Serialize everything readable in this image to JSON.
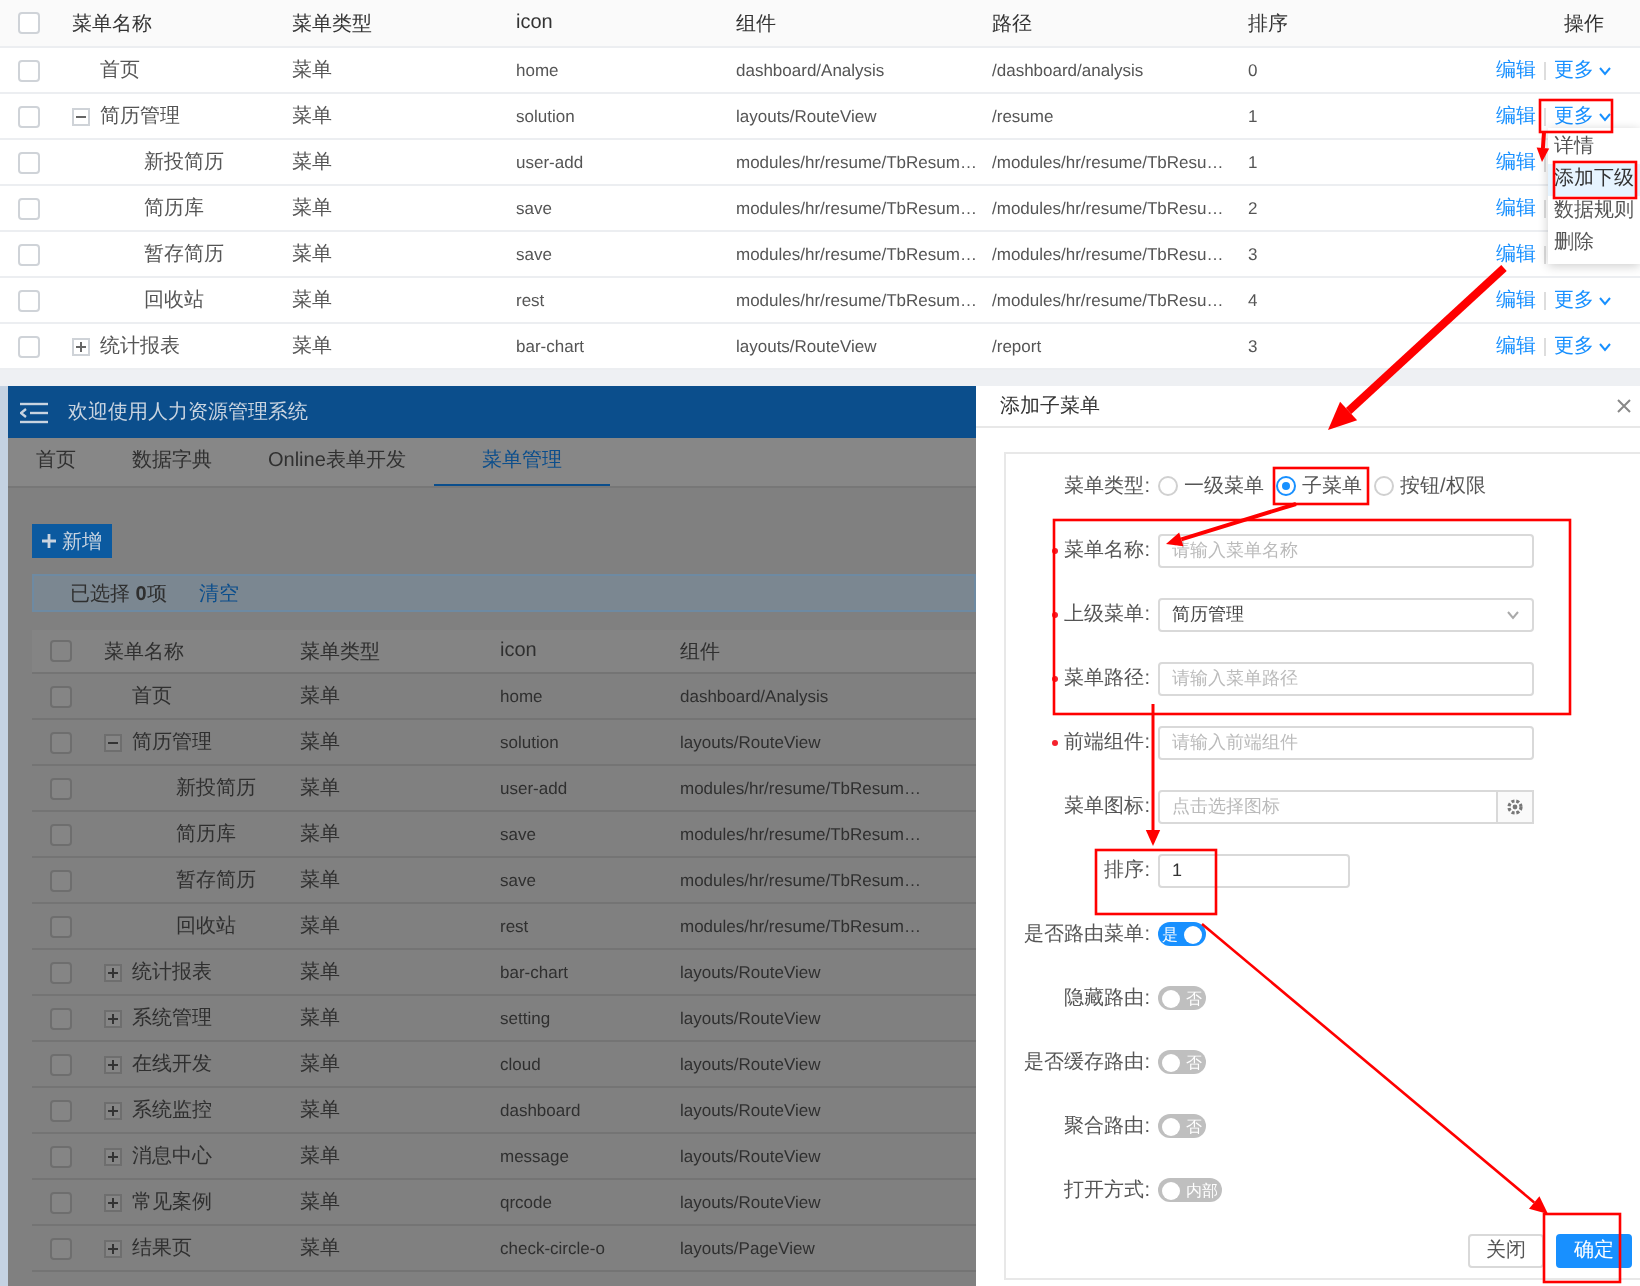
{
  "top_table": {
    "header_checked": false,
    "columns": [
      "菜单名称",
      "菜单类型",
      "icon",
      "组件",
      "路径",
      "排序",
      "操作"
    ],
    "rows": [
      {
        "kind": "leaf",
        "checked": false,
        "name": "首页",
        "type": "菜单",
        "icon": "home",
        "component": "dashboard/Analysis",
        "path": "/dashboard/analysis",
        "order": "0",
        "actions": [
          "编辑",
          "更多"
        ]
      },
      {
        "kind": "group",
        "expanded": true,
        "checked": false,
        "name": "简历管理",
        "type": "菜单",
        "icon": "solution",
        "component": "layouts/RouteView",
        "path": "/resume",
        "order": "1",
        "actions": [
          "编辑",
          "更多"
        ],
        "children": [
          {
            "kind": "leaf",
            "checked": false,
            "name": "新投简历",
            "type": "菜单",
            "icon": "user-add",
            "component": "modules/hr/resume/TbResum…",
            "path": "/modules/hr/resume/TbResu…",
            "order": "1",
            "actions": [
              "编辑"
            ]
          },
          {
            "kind": "leaf",
            "checked": false,
            "name": "简历库",
            "type": "菜单",
            "icon": "save",
            "component": "modules/hr/resume/TbResum…",
            "path": "/modules/hr/resume/TbResu…",
            "order": "2",
            "actions": [
              "编辑"
            ]
          },
          {
            "kind": "leaf",
            "checked": false,
            "name": "暂存简历",
            "type": "菜单",
            "icon": "save",
            "component": "modules/hr/resume/TbResum…",
            "path": "/modules/hr/resume/TbResu…",
            "order": "3",
            "actions": [
              "编辑"
            ]
          },
          {
            "kind": "leaf",
            "checked": false,
            "name": "回收站",
            "type": "菜单",
            "icon": "rest",
            "component": "modules/hr/resume/TbResum…",
            "path": "/modules/hr/resume/TbResu…",
            "order": "4",
            "actions": [
              "编辑",
              "更多"
            ]
          }
        ]
      },
      {
        "kind": "group",
        "expanded": false,
        "checked": false,
        "name": "统计报表",
        "type": "菜单",
        "icon": "bar-chart",
        "component": "layouts/RouteView",
        "path": "/report",
        "order": "3",
        "actions": [
          "编辑",
          "更多"
        ]
      }
    ]
  },
  "action_menu": {
    "items": [
      {
        "label": "详情",
        "selected": false
      },
      {
        "label": "添加下级",
        "selected": true
      },
      {
        "label": "数据规则",
        "selected": false
      },
      {
        "label": "删除",
        "selected": false
      }
    ]
  },
  "app": {
    "title": "欢迎使用人力资源管理系统",
    "tabs": [
      {
        "label": "首页",
        "selected": false
      },
      {
        "label": "数据字典",
        "selected": false
      },
      {
        "label": "Online表单开发",
        "selected": false
      },
      {
        "label": "菜单管理",
        "selected": true
      }
    ],
    "add_button": "新增",
    "selection": {
      "text": "已选择 **0**项",
      "clear": "清空"
    },
    "table": {
      "header_checked": false,
      "columns": [
        "菜单名称",
        "菜单类型",
        "icon",
        "组件"
      ],
      "rows": [
        {
          "kind": "leaf",
          "checked": false,
          "name": "首页",
          "type": "菜单",
          "icon": "home",
          "component": "dashboard/Analysis"
        },
        {
          "kind": "group",
          "expanded": true,
          "checked": false,
          "name": "简历管理",
          "type": "菜单",
          "icon": "solution",
          "component": "layouts/RouteView",
          "children": [
            {
              "kind": "leaf",
              "checked": false,
              "name": "新投简历",
              "type": "菜单",
              "icon": "user-add",
              "component": "modules/hr/resume/TbResum…"
            },
            {
              "kind": "leaf",
              "checked": false,
              "name": "简历库",
              "type": "菜单",
              "icon": "save",
              "component": "modules/hr/resume/TbResum…"
            },
            {
              "kind": "leaf",
              "checked": false,
              "name": "暂存简历",
              "type": "菜单",
              "icon": "save",
              "component": "modules/hr/resume/TbResum…"
            },
            {
              "kind": "leaf",
              "checked": false,
              "name": "回收站",
              "type": "菜单",
              "icon": "rest",
              "component": "modules/hr/resume/TbResum…"
            }
          ]
        },
        {
          "kind": "group",
          "expanded": false,
          "checked": false,
          "name": "统计报表",
          "type": "菜单",
          "icon": "bar-chart",
          "component": "layouts/RouteView"
        },
        {
          "kind": "group",
          "expanded": false,
          "checked": false,
          "name": "系统管理",
          "type": "菜单",
          "icon": "setting",
          "component": "layouts/RouteView"
        },
        {
          "kind": "group",
          "expanded": false,
          "checked": false,
          "name": "在线开发",
          "type": "菜单",
          "icon": "cloud",
          "component": "layouts/RouteView"
        },
        {
          "kind": "group",
          "expanded": false,
          "checked": false,
          "name": "系统监控",
          "type": "菜单",
          "icon": "dashboard",
          "component": "layouts/RouteView"
        },
        {
          "kind": "group",
          "expanded": false,
          "checked": false,
          "name": "消息中心",
          "type": "菜单",
          "icon": "message",
          "component": "layouts/RouteView"
        },
        {
          "kind": "group",
          "expanded": false,
          "checked": false,
          "name": "常见案例",
          "type": "菜单",
          "icon": "qrcode",
          "component": "layouts/RouteView"
        },
        {
          "kind": "group",
          "expanded": false,
          "checked": false,
          "name": "结果页",
          "type": "菜单",
          "icon": "check-circle-o",
          "component": "layouts/PageView"
        }
      ]
    }
  },
  "drawer": {
    "title": "添加子菜单",
    "fields": [
      {
        "kind": "radio",
        "label": "菜单类型:",
        "options": [
          {
            "label": "一级菜单",
            "selected": false
          },
          {
            "label": "子菜单",
            "selected": true
          },
          {
            "label": "按钮/权限",
            "selected": false
          }
        ]
      },
      {
        "kind": "input",
        "label": "菜单名称:",
        "required": true,
        "placeholder": "请输入菜单名称"
      },
      {
        "kind": "select",
        "label": "上级菜单:",
        "required": true,
        "value": "简历管理"
      },
      {
        "kind": "input",
        "label": "菜单路径:",
        "required": true,
        "placeholder": "请输入菜单路径"
      },
      {
        "kind": "input",
        "label": "前端组件:",
        "required": true,
        "placeholder": "请输入前端组件"
      },
      {
        "kind": "icon_picker",
        "label": "菜单图标:",
        "required": false,
        "placeholder": "点击选择图标"
      },
      {
        "kind": "number",
        "label": "排序:",
        "required": false,
        "value": "1"
      },
      {
        "kind": "switch",
        "label": "是否路由菜单:",
        "on": true,
        "text": "是"
      },
      {
        "kind": "switch",
        "label": "隐藏路由:",
        "on": false,
        "text": "否"
      },
      {
        "kind": "switch",
        "label": "是否缓存路由:",
        "on": false,
        "text": "否"
      },
      {
        "kind": "switch",
        "label": "聚合路由:",
        "on": false,
        "text": "否"
      },
      {
        "kind": "switch",
        "label": "打开方式:",
        "on": false,
        "text": "内部"
      }
    ],
    "buttons": [
      {
        "kind": "default",
        "label": "关闭"
      },
      {
        "kind": "primary",
        "label": "确定"
      }
    ]
  }
}
